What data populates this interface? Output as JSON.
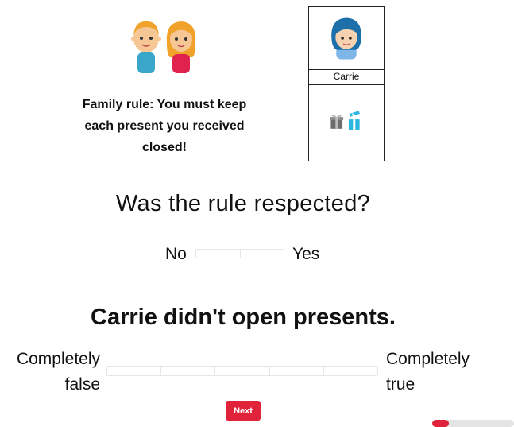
{
  "rule": {
    "lines": [
      "Family rule: You must keep",
      "each present you received",
      "closed!"
    ]
  },
  "card": {
    "name": "Carrie"
  },
  "question": "Was the rule respected?",
  "binary_slider": {
    "left_label": "No",
    "right_label": "Yes",
    "segments": 2
  },
  "statement": "Carrie didn't open presents.",
  "scale_slider": {
    "left_label_lines": [
      "Completely",
      "false"
    ],
    "right_label_lines": [
      "Completely",
      "true"
    ],
    "segments": 5
  },
  "next_label": "Next",
  "progress": {
    "fraction": 0.2,
    "color": "#e0233a"
  },
  "colors": {
    "accent": "#e0233a"
  },
  "icons": [
    "kids-illustration",
    "carrie-portrait",
    "gift-closed-icon",
    "gift-open-icon"
  ]
}
